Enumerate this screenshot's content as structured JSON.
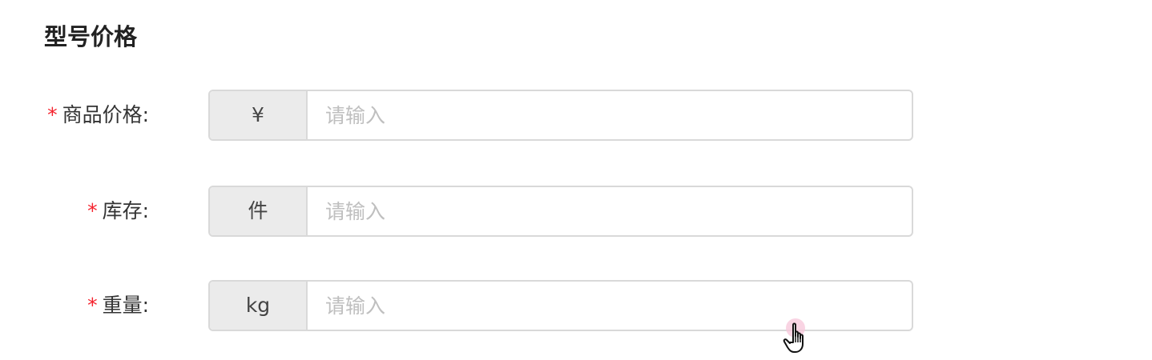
{
  "section": {
    "title": "型号价格"
  },
  "form": {
    "fields": [
      {
        "label": "商品价格:",
        "required_mark": "*",
        "addon": "¥",
        "placeholder": "请输入",
        "value": ""
      },
      {
        "label": "库存:",
        "required_mark": "*",
        "addon": "件",
        "placeholder": "请输入",
        "value": ""
      },
      {
        "label": "重量:",
        "required_mark": "*",
        "addon": "kg",
        "placeholder": "请输入",
        "value": ""
      }
    ]
  },
  "colors": {
    "required": "#f5222d",
    "addon_background": "#ebebeb",
    "border": "#d9d9d9",
    "placeholder": "#bfbfbf"
  },
  "icons": {
    "cursor": "hand-pointer-icon"
  }
}
